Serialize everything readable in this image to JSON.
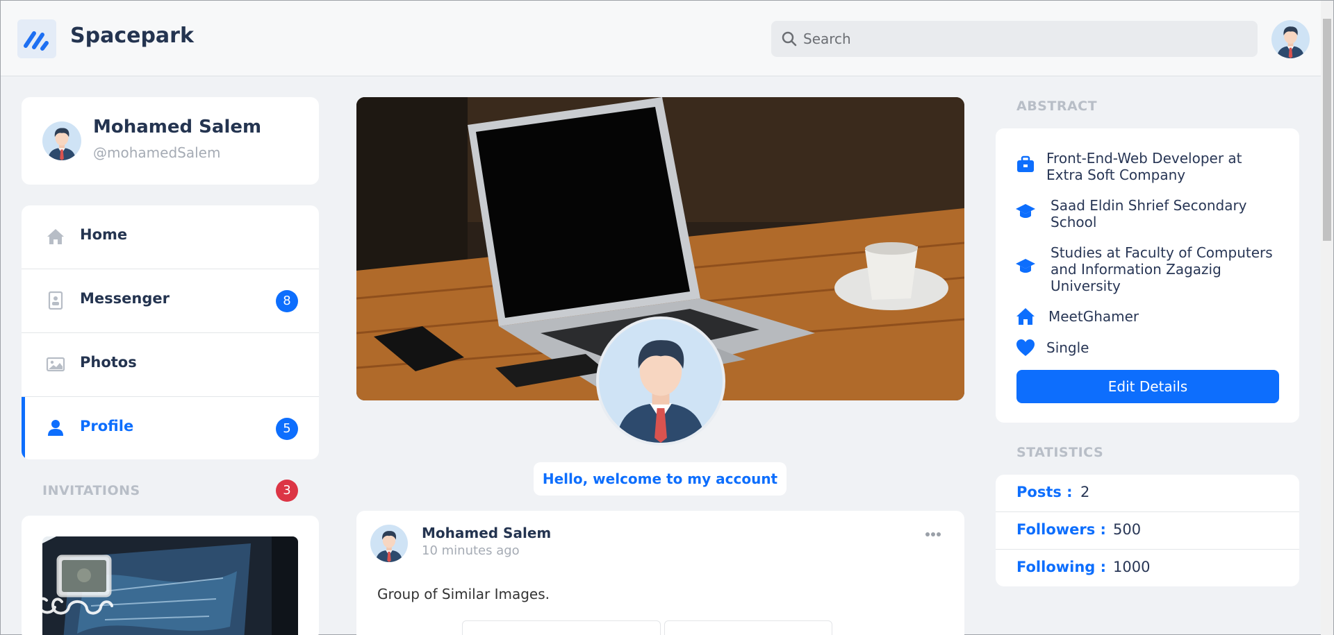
{
  "app": {
    "brand": "Spacepark"
  },
  "search": {
    "placeholder": "Search"
  },
  "user": {
    "name": "Mohamed Salem",
    "handle": "@mohamedSalem"
  },
  "nav": {
    "items": [
      {
        "label": "Home",
        "icon": "home-icon",
        "badge": ""
      },
      {
        "label": "Messenger",
        "icon": "contact-book-icon",
        "badge": "8"
      },
      {
        "label": "Photos",
        "icon": "image-icon",
        "badge": ""
      },
      {
        "label": "Profile",
        "icon": "user-icon",
        "badge": "5",
        "active": true
      }
    ]
  },
  "invitations": {
    "title": "INVITATIONS",
    "count": "3"
  },
  "cover": {
    "welcome": "Hello, welcome to my account"
  },
  "post": {
    "author": "Mohamed Salem",
    "time": "10 minutes ago",
    "text": "Group of Similar Images."
  },
  "abstract": {
    "title": "ABSTRACT",
    "items": [
      {
        "icon": "briefcase-icon",
        "text": "Front-End-Web Developer at Extra Soft Company"
      },
      {
        "icon": "graduation-cap-icon",
        "text": "Saad Eldin Shrief Secondary School"
      },
      {
        "icon": "graduation-cap-icon",
        "text": "Studies at Faculty of Computers and Information Zagazig University"
      },
      {
        "icon": "home-icon",
        "text": "MeetGhamer"
      },
      {
        "icon": "heart-icon",
        "text": "Single"
      }
    ],
    "edit_label": "Edit Details"
  },
  "statistics": {
    "title": "STATISTICS",
    "rows": [
      {
        "label": "Posts :",
        "value": "2"
      },
      {
        "label": "Followers :",
        "value": "500"
      },
      {
        "label": "Following :",
        "value": "1000"
      }
    ]
  },
  "colors": {
    "accent": "#0d6efd",
    "danger": "#dc3545",
    "background": "#f0f2f5",
    "text": "#243450"
  }
}
